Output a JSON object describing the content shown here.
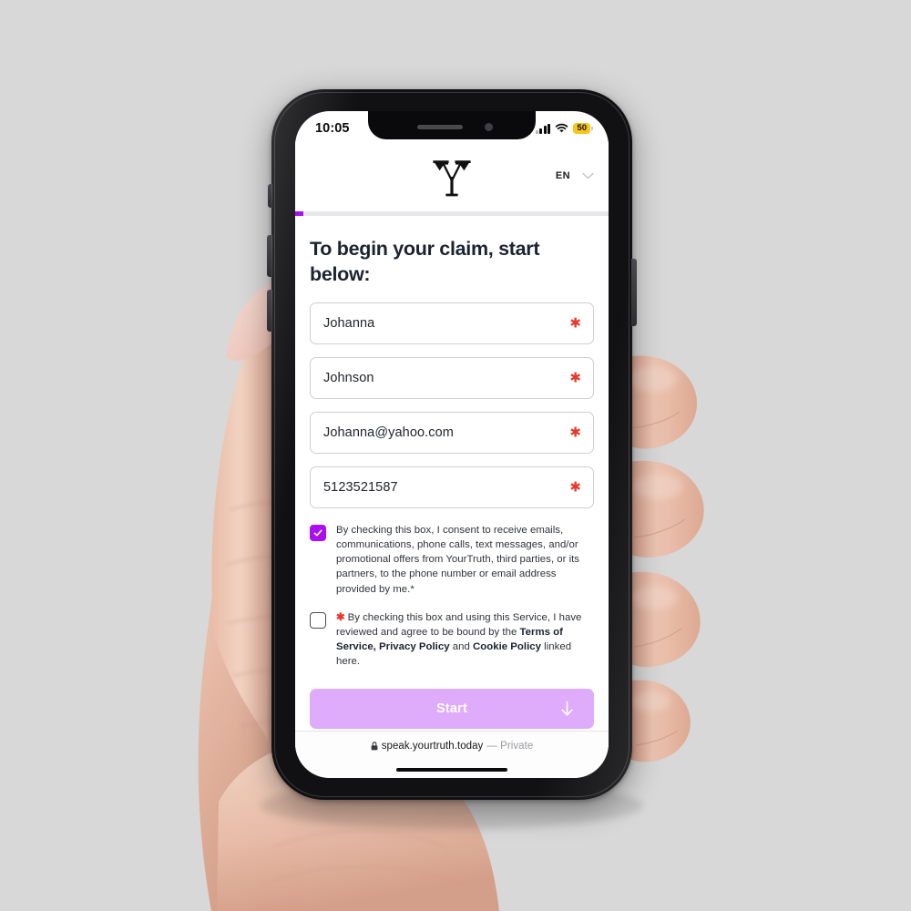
{
  "device": {
    "type": "smartphone",
    "orientation": "portrait",
    "frame_color": "#111113",
    "held_in_hand": true
  },
  "status_bar": {
    "time": "10:05",
    "signal_icon": "cellular-signal-icon",
    "wifi_icon": "wifi-icon",
    "battery_level": "50",
    "battery_state_color": "#f5c518"
  },
  "site_header": {
    "logo_name": "yourtruth-y-logo",
    "language_label": "EN",
    "language_chevron": "chevron-down-icon"
  },
  "progress": {
    "percent": 2.5,
    "fill_color": "#aa0ff0",
    "track_color": "#e7e6e8"
  },
  "form": {
    "headline": "To begin your claim, start below:",
    "required_marker": "✱",
    "fields": [
      {
        "name": "first-name",
        "value": "Johanna",
        "required": true
      },
      {
        "name": "last-name",
        "value": "Johnson",
        "required": true
      },
      {
        "name": "email",
        "value": "Johanna@yahoo.com",
        "required": true
      },
      {
        "name": "phone",
        "value": "5123521587",
        "required": true
      }
    ],
    "consents": [
      {
        "name": "marketing-consent",
        "checked": true,
        "required_marker_before": false,
        "text": "By checking this box, I consent to receive emails, communications, phone calls, text messages, and/or promotional offers from YourTruth, third parties, or its partners, to the phone number or email address provided by me.*"
      },
      {
        "name": "terms-consent",
        "checked": false,
        "required_marker_before": true,
        "text_part_1": "By checking this box and using this Service, I have reviewed and agree to be bound by the ",
        "link_1": "Terms of Service, Privacy Policy",
        "text_part_2": " and ",
        "link_2": "Cookie Policy",
        "text_part_3": " linked here."
      }
    ],
    "submit": {
      "label": "Start",
      "arrow_icon": "arrow-down-icon",
      "background_color": "#dfabfb",
      "text_color": "#ffffff"
    }
  },
  "browser": {
    "lock_icon": "lock-icon",
    "url": "speak.yourtruth.today",
    "privacy_label": "— Private"
  },
  "colors": {
    "accent_purple": "#aa0ff0",
    "button_purple": "#dfabfb",
    "required_red": "#e8372c",
    "heading_navy": "#1c2330",
    "page_background": "#d8d8d8"
  }
}
